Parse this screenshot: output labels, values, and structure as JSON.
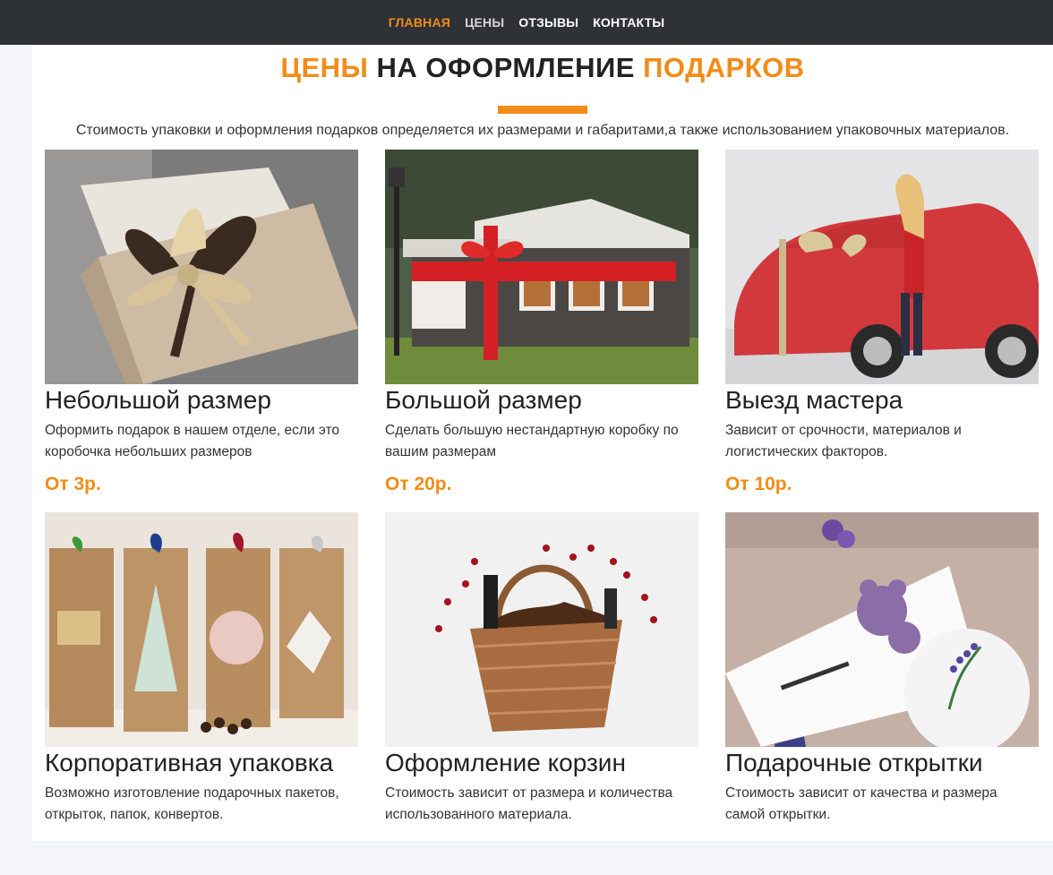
{
  "nav": {
    "items": [
      {
        "label": "ГЛАВНАЯ"
      },
      {
        "label": "ЦЕНЫ"
      },
      {
        "label": "ОТЗЫВЫ"
      },
      {
        "label": "КОНТАКТЫ"
      }
    ]
  },
  "header": {
    "title_part1": "ЦЕНЫ",
    "title_part2": "НА ОФОРМЛЕНИЕ",
    "title_part3": "ПОДАРКОВ",
    "subtitle": "Стоимость упаковки и оформления подарков определяется их размерами и габаритами,а также использованием упаковочных материалов."
  },
  "colors": {
    "accent": "#f28c18",
    "navbar": "#2e3135"
  },
  "cards": [
    {
      "title": "Небольшой размер",
      "text": "Оформить подарок в нашем отделе, если это коробочка небольших размеров",
      "price": "От 3р.",
      "image": "gift-box-with-ribbon-photo"
    },
    {
      "title": "Большой размер",
      "text": "Сделать большую нестандартную коробку по вашим размерам",
      "price": "От 20р.",
      "image": "house-wrapped-with-red-ribbon-photo"
    },
    {
      "title": "Выезд мастера",
      "text": "Зависит от срочности, материалов и логистических факторов.",
      "price": "От 10р.",
      "image": "car-wrapped-in-gift-paper-photo"
    },
    {
      "title": "Корпоративная упаковка",
      "text": "Возможно изготовление подарочных пакетов, открыток, папок, конвертов.",
      "image": "craft-gift-bags-photo"
    },
    {
      "title": "Оформление корзин",
      "text": "Стоимость зависит от размера и количества использованного материала.",
      "image": "decorated-wicker-basket-photo"
    },
    {
      "title": "Подарочные открытки",
      "text": "Стоимость зависит от качества и размера самой открытки.",
      "image": "greeting-card-photo"
    }
  ]
}
